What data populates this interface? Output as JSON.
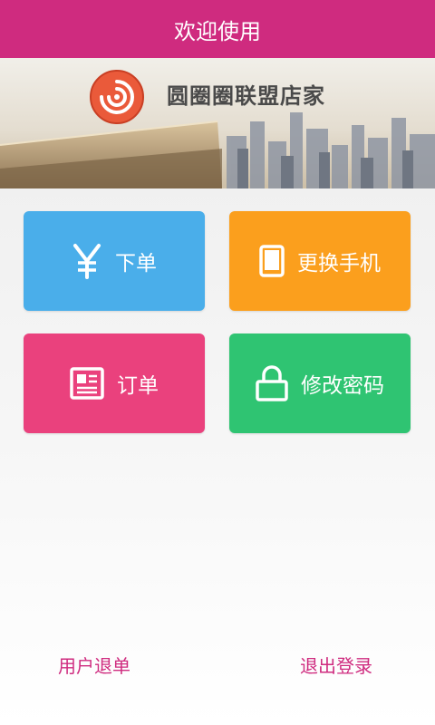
{
  "header": {
    "title": "欢迎使用"
  },
  "banner": {
    "brand_name": "圆圈圈联盟店家"
  },
  "tiles": {
    "place_order": {
      "label": "下单",
      "icon": "yen-icon",
      "color": "#4aaeea"
    },
    "change_phone": {
      "label": "更换手机",
      "icon": "phone-icon",
      "color": "#fb9f1d"
    },
    "orders": {
      "label": "订单",
      "icon": "document-icon",
      "color": "#ea417d"
    },
    "change_password": {
      "label": "修改密码",
      "icon": "lock-icon",
      "color": "#2fc472"
    }
  },
  "footer": {
    "refund_label": "用户退单",
    "logout_label": "退出登录"
  },
  "colors": {
    "brand": "#cf2b7f"
  }
}
